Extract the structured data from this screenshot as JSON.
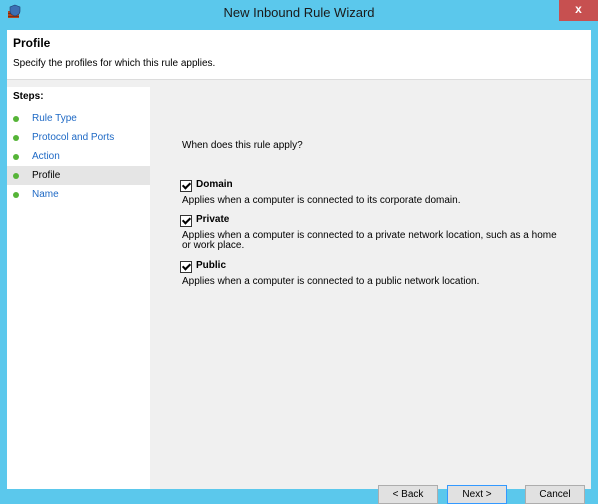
{
  "window": {
    "title": "New Inbound Rule Wizard",
    "close_glyph": "x"
  },
  "header": {
    "title": "Profile",
    "subtitle": "Specify the profiles for which this rule applies."
  },
  "steps": {
    "title": "Steps:",
    "items": [
      {
        "label": "Rule Type"
      },
      {
        "label": "Protocol and Ports"
      },
      {
        "label": "Action"
      },
      {
        "label": "Profile"
      },
      {
        "label": "Name"
      }
    ],
    "current_index": 3
  },
  "content": {
    "question": "When does this rule apply?",
    "options": [
      {
        "label": "Domain",
        "checked": true,
        "description": "Applies when a computer is connected to its corporate domain."
      },
      {
        "label": "Private",
        "checked": true,
        "description": "Applies when a computer is connected to a private network location, such as a home or work place."
      },
      {
        "label": "Public",
        "checked": true,
        "description": "Applies when a computer is connected to a public network location."
      }
    ]
  },
  "buttons": {
    "back": "< Back",
    "next": "Next >",
    "cancel": "Cancel"
  },
  "colors": {
    "titlebar": "#5bc8ec",
    "close": "#c75050",
    "step_dot": "#55b437",
    "link": "#1e69c5"
  },
  "icons": {
    "app": "firewall-shield-icon",
    "check": "checkmark-icon"
  }
}
